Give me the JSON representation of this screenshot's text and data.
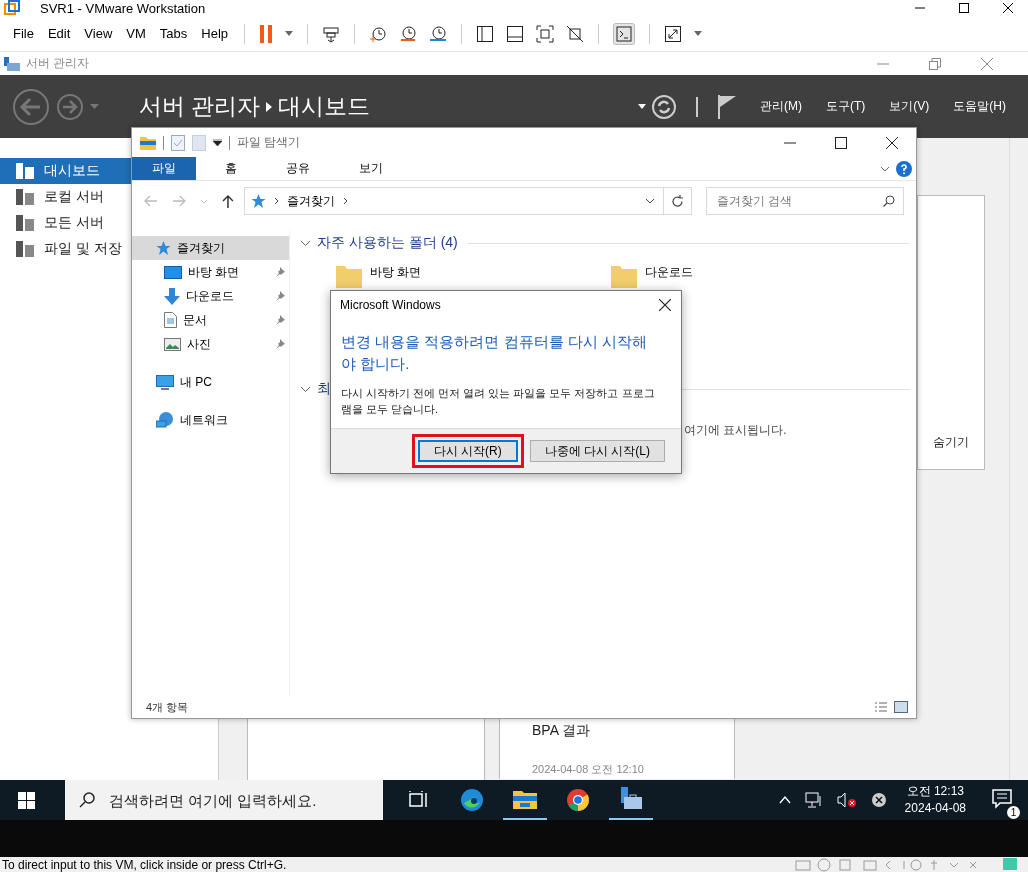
{
  "window": {
    "title": "SVR1 - VMware Workstation"
  },
  "menu": [
    "File",
    "Edit",
    "View",
    "VM",
    "Tabs",
    "Help"
  ],
  "server_manager": {
    "title": "서버 관리자",
    "breadcrumb": [
      "서버 관리자",
      "대시보드"
    ],
    "menus": [
      "관리(M)",
      "도구(T)",
      "보기(V)",
      "도움말(H)"
    ],
    "nav": [
      {
        "label": "대시보드",
        "selected": true
      },
      {
        "label": "로컬 서버",
        "selected": false
      },
      {
        "label": "모든 서버",
        "selected": false
      },
      {
        "label": "파일 및 저장",
        "selected": false
      }
    ],
    "hide_label": "숨기기",
    "card_title": "BPA 결과",
    "card_time": "2024-04-08 오전 12:10"
  },
  "explorer": {
    "title": "파일 탐색기",
    "ribbon_tabs": [
      {
        "label": "파일",
        "selected": true
      },
      {
        "label": "홈",
        "selected": false
      },
      {
        "label": "공유",
        "selected": false
      },
      {
        "label": "보기",
        "selected": false
      }
    ],
    "address": "즐겨찾기",
    "search": {
      "placeholder": "즐겨찾기 검색"
    },
    "tree": [
      {
        "label": "즐겨찾기",
        "selected": true,
        "children": [
          {
            "label": "바탕 화면",
            "pinned": true
          },
          {
            "label": "다운로드",
            "pinned": true
          },
          {
            "label": "문서",
            "pinned": true
          },
          {
            "label": "사진",
            "pinned": true
          }
        ]
      },
      {
        "label": "내 PC",
        "selected": false
      },
      {
        "label": "네트워크",
        "selected": false
      }
    ],
    "sections": [
      {
        "title": "자주 사용하는 폴더 (4)",
        "folders": [
          "바탕 화면",
          "다운로드"
        ]
      },
      {
        "title": "최",
        "note": "여기에 표시됩니다."
      }
    ],
    "status": "4개 항목"
  },
  "dialog": {
    "title": "Microsoft Windows",
    "heading": "변경 내용을 적용하려면 컴퓨터를 다시 시작해야 합니다.",
    "body": "다시 시작하기 전에 먼저 열려 있는 파일을 모두 저장하고 프로그램을 모두 닫습니다.",
    "buttons": [
      {
        "label": "다시 시작(R)",
        "selected": true,
        "highlighted": true
      },
      {
        "label": "나중에 다시 시작(L)",
        "selected": false,
        "highlighted": false
      }
    ]
  },
  "taskbar": {
    "search": {
      "placeholder": "검색하려면 여기에 입력하세요."
    },
    "apps": [
      {
        "kind": "taskview",
        "running": false
      },
      {
        "kind": "edge",
        "running": false
      },
      {
        "kind": "explorer",
        "running": true
      },
      {
        "kind": "chrome",
        "running": false
      },
      {
        "kind": "servermanager",
        "running": true
      }
    ],
    "time": "오전 12:13",
    "date": "2024-04-08",
    "notifications": "1"
  },
  "status_bar": "To direct input to this VM, click inside or press Ctrl+G."
}
